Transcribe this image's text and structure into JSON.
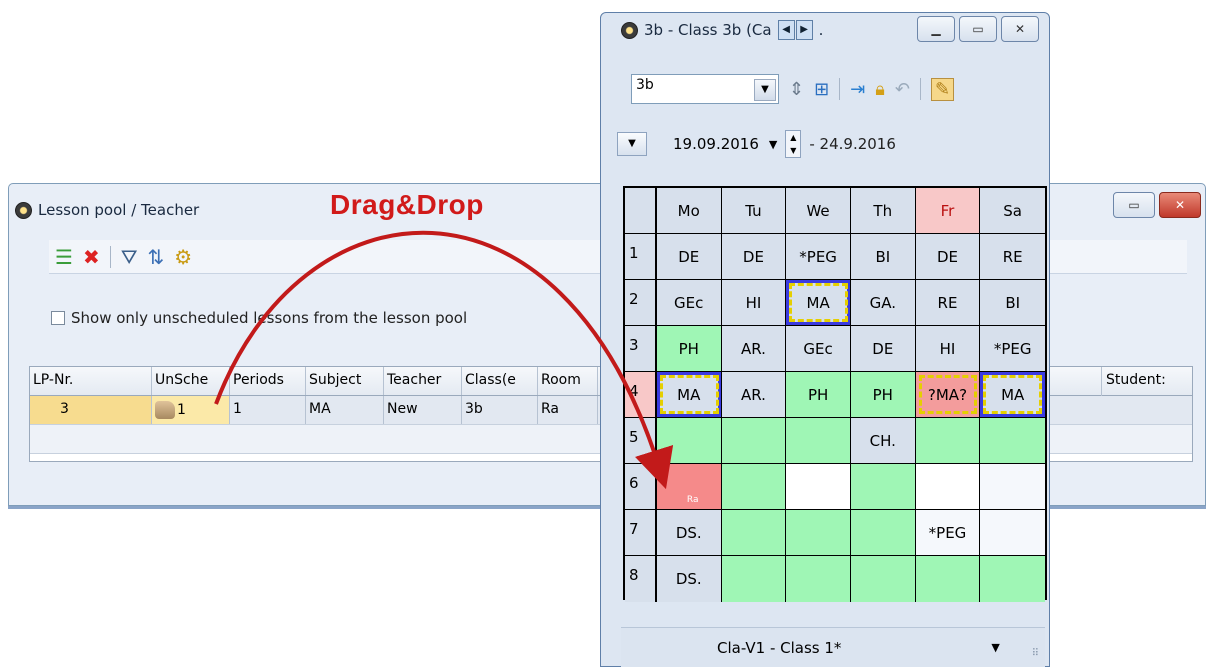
{
  "lesson_pool": {
    "title": "Lesson pool / Teacher",
    "checkbox_label": "Show only unscheduled lessons from the lesson pool",
    "checkbox_checked": false,
    "columns": [
      "LP-Nr.",
      "UnSche",
      "Periods",
      "Subject",
      "Teacher",
      "Class(e",
      "Room"
    ],
    "extra_column": "Student:",
    "rows": [
      {
        "lp_nr": "3",
        "unscheduled": "1",
        "periods": "1",
        "subject": "MA",
        "teacher": "New",
        "classes": "3b",
        "room": "Ra"
      }
    ]
  },
  "timetable": {
    "title": "3b - Class 3b (Ca",
    "title_suffix": ".",
    "element_select": "3b",
    "date_start": "19.09.2016",
    "date_end": "- 24.9.2016",
    "days": [
      "Mo",
      "Tu",
      "We",
      "Th",
      "Fr",
      "Sa"
    ],
    "periods": [
      {
        "n": "1",
        "cells": [
          "DE",
          "DE",
          "*PEG",
          "BI",
          "DE",
          "RE"
        ]
      },
      {
        "n": "2",
        "cells": [
          "GEc",
          "HI",
          "MA",
          "GA.",
          "RE",
          "BI"
        ]
      },
      {
        "n": "3",
        "cells": [
          "PH",
          "AR.",
          "GEc",
          "DE",
          "HI",
          "*PEG"
        ]
      },
      {
        "n": "4",
        "cells": [
          "MA",
          "AR.",
          "PH",
          "PH",
          "?MA?",
          "MA"
        ]
      },
      {
        "n": "5",
        "cells": [
          "",
          "",
          "",
          "CH.",
          "",
          ""
        ]
      },
      {
        "n": "6",
        "cells": [
          "Ra",
          "",
          "",
          "",
          "",
          ""
        ]
      },
      {
        "n": "7",
        "cells": [
          "DS.",
          "",
          "",
          "",
          "*PEG",
          ""
        ]
      },
      {
        "n": "8",
        "cells": [
          "DS.",
          "",
          "",
          "",
          "",
          ""
        ]
      }
    ],
    "footer_select": "Cla-V1 - Class 1*"
  },
  "annotation": "Drag&Drop",
  "colors": {
    "arrow": "#c21a1a",
    "free_slot": "#9ff6b5",
    "drop_target": "#f58a8a"
  }
}
